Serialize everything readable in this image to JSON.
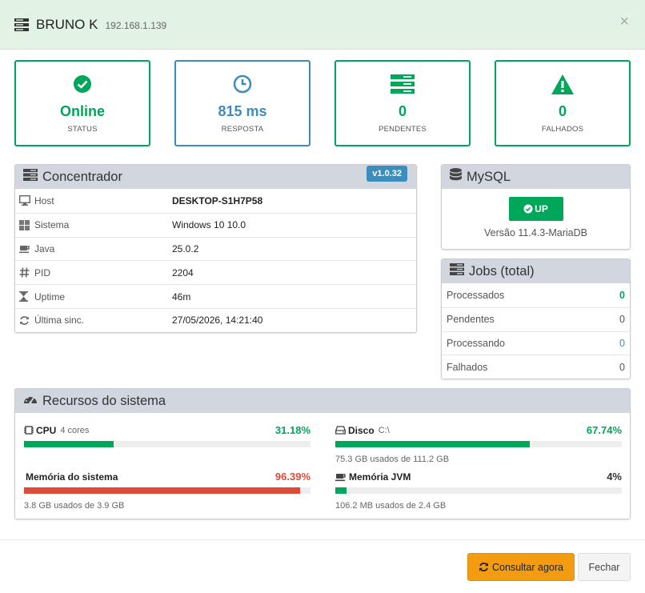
{
  "header": {
    "title": "BRUNO K",
    "ip": "192.168.1.139",
    "close_label": "×"
  },
  "stats": [
    {
      "value": "Online",
      "label": "STATUS",
      "color": "#00a65a",
      "icon": "check-circle-icon"
    },
    {
      "value": "815 ms",
      "label": "RESPOSTA",
      "color": "#3c8dbc",
      "icon": "clock-icon"
    },
    {
      "value": "0",
      "label": "PENDENTES",
      "color": "#00a65a",
      "icon": "server-stack-icon"
    },
    {
      "value": "0",
      "label": "FALHADOS",
      "color": "#00a65a",
      "icon": "warning-icon"
    }
  ],
  "concentrador": {
    "title": "Concentrador",
    "version": "v1.0.32",
    "rows": [
      {
        "key": "Host",
        "value": "DESKTOP-S1H7P58",
        "icon": "monitor-icon"
      },
      {
        "key": "Sistema",
        "value": "Windows 10 10.0",
        "icon": "windows-icon"
      },
      {
        "key": "Java",
        "value": "25.0.2",
        "icon": "coffee-icon"
      },
      {
        "key": "PID",
        "value": "2204",
        "icon": "hash-icon"
      },
      {
        "key": "Uptime",
        "value": "46m",
        "icon": "hourglass-icon"
      },
      {
        "key": "Última sinc.",
        "value": "27/05/2026, 14:21:40",
        "icon": "refresh-icon"
      }
    ]
  },
  "mysql": {
    "title": "MySQL",
    "status": "UP",
    "version_text": "Versão 11.4.3-MariaDB"
  },
  "jobs": {
    "title": "Jobs (total)",
    "rows": [
      {
        "label": "Processados",
        "value": "0",
        "color": "#00a65a"
      },
      {
        "label": "Pendentes",
        "value": "0",
        "color": "#555"
      },
      {
        "label": "Processando",
        "value": "0",
        "color": "#3c8dbc"
      },
      {
        "label": "Falhados",
        "value": "0",
        "color": "#555"
      }
    ]
  },
  "resources": {
    "title": "Recursos do sistema",
    "cpu": {
      "name": "CPU",
      "sub": "4 cores",
      "pct": "31.18%",
      "fraction": 0.3118,
      "color": "#00a65a"
    },
    "disk": {
      "name": "Disco",
      "sub": "C:\\",
      "pct": "67.74%",
      "fraction": 0.6774,
      "color": "#00a65a",
      "note": "75.3 GB usados de 111.2 GB"
    },
    "mem": {
      "name": "Memória do sistema",
      "pct": "96.39%",
      "fraction": 0.9639,
      "color": "#dd4b39",
      "note": "3.8 GB usados de 3.9 GB"
    },
    "jvm": {
      "name": "Memória JVM",
      "pct": "4%",
      "fraction": 0.04,
      "color": "#00a65a",
      "note": "106.2 MB usados de 2.4 GB"
    }
  },
  "footer": {
    "primary_label": "Consultar agora",
    "secondary_label": "Fechar"
  }
}
